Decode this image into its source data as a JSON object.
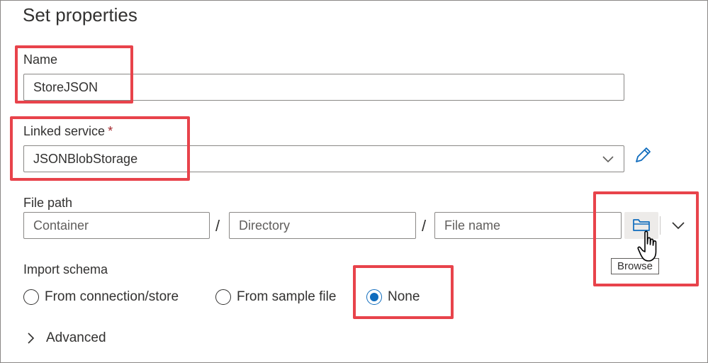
{
  "header": {
    "title": "Set properties"
  },
  "name": {
    "label": "Name",
    "value": "StoreJSON"
  },
  "linked_service": {
    "label": "Linked service",
    "required_marker": "*",
    "value": "JSONBlobStorage"
  },
  "file_path": {
    "label": "File path",
    "container_placeholder": "Container",
    "directory_placeholder": "Directory",
    "file_name_placeholder": "File name",
    "separator": "/",
    "browse_tooltip": "Browse"
  },
  "import_schema": {
    "label": "Import schema",
    "options": [
      {
        "label": "From connection/store",
        "checked": false
      },
      {
        "label": "From sample file",
        "checked": false
      },
      {
        "label": "None",
        "checked": true
      }
    ]
  },
  "advanced": {
    "label": "Advanced"
  },
  "colors": {
    "accent": "#0f6cbd",
    "highlight": "#e8434b",
    "required": "#a4262c"
  },
  "icons": [
    "edit-pencil-icon",
    "folder-icon",
    "chevron-down-icon",
    "chevron-right-icon",
    "hand-cursor-icon"
  ]
}
